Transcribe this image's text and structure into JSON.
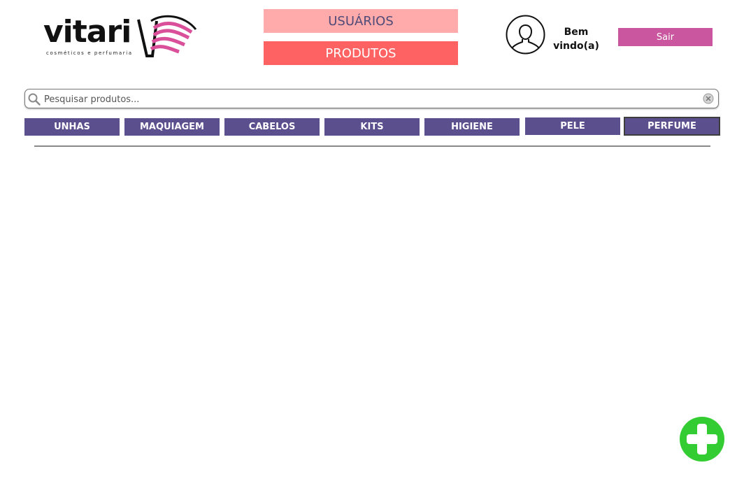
{
  "brand": {
    "name": "vitari",
    "tagline": "cosméticos e perfumaria"
  },
  "nav": {
    "usuarios": "USUÁRIOS",
    "produtos": "PRODUTOS"
  },
  "user": {
    "welcome": "Bem vindo(a)",
    "logout": "Sair"
  },
  "search": {
    "placeholder": "Pesquisar produtos..."
  },
  "categories": [
    "UNHAS",
    "MAQUIAGEM",
    "CABELOS",
    "KITS",
    "HIGIENE",
    "PELE",
    "PERFUME"
  ],
  "colors": {
    "nav_usuarios_bg": "#ffabab",
    "nav_produtos_bg": "#ff6262",
    "logout_bg": "#c9569e",
    "category_bg": "#5b4f8e",
    "add_button": "#33cc33"
  },
  "icons": {
    "search": "search-icon",
    "clear": "clear-icon",
    "avatar": "user-icon",
    "add": "plus-icon"
  }
}
